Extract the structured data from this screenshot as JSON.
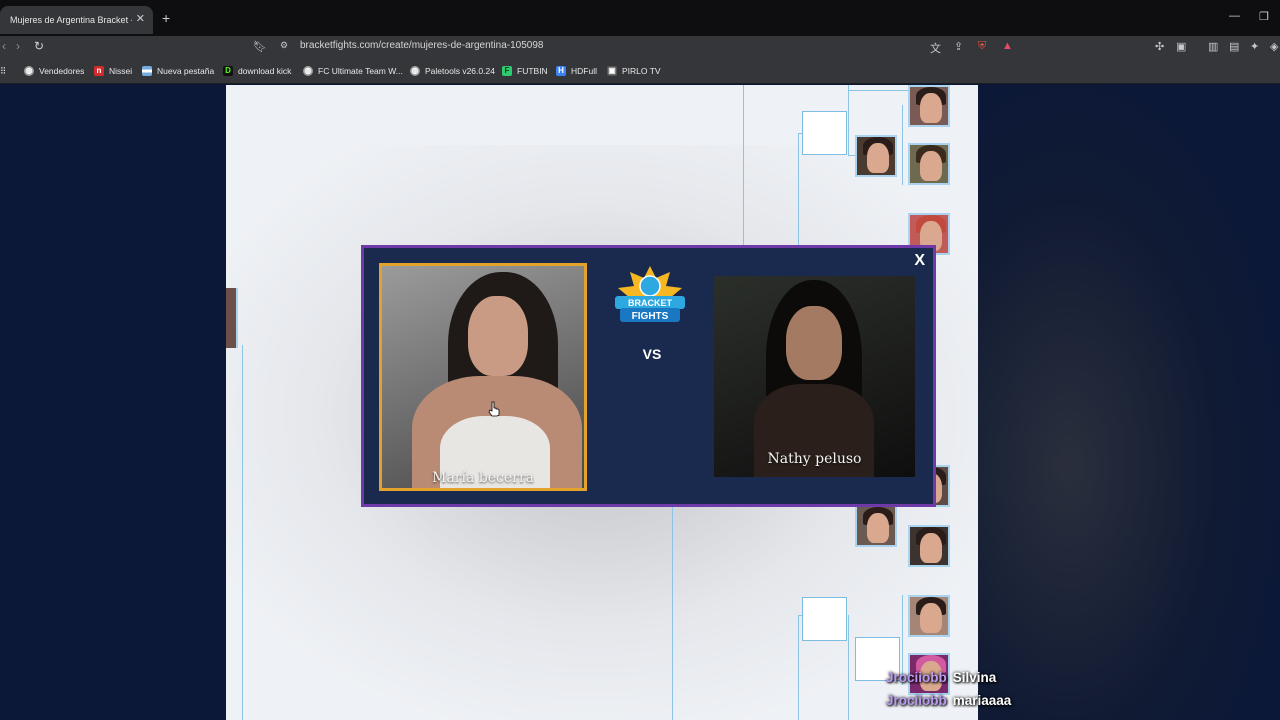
{
  "browser": {
    "tab_title": "Mujeres de Argentina Bracket - B",
    "tab_close": "✕",
    "new_tab": "+",
    "url": "bracketfights.com/create/mujeres-de-argentina-105098",
    "bookmarks": [
      {
        "label": "Vendedores",
        "icon": "globe-icon",
        "color": "#bdbdbd"
      },
      {
        "label": "Nissei",
        "icon": "nissei-icon",
        "color": "#d12b2b"
      },
      {
        "label": "Nueva pestaña",
        "icon": "argentina-flag-icon",
        "color": "#74acdf"
      },
      {
        "label": "download kick",
        "icon": "kick-icon",
        "color": "#53fc18"
      },
      {
        "label": "FC Ultimate Team W...",
        "icon": "globe-icon",
        "color": "#bdbdbd"
      },
      {
        "label": "Paletools v26.0.24",
        "icon": "globe-icon",
        "color": "#bdbdbd"
      },
      {
        "label": "FUTBIN",
        "icon": "futbin-icon",
        "color": "#2ecc71"
      },
      {
        "label": "HDFull",
        "icon": "hdfull-icon",
        "color": "#3b82f6"
      },
      {
        "label": "PIRLO TV",
        "icon": "pirlo-icon",
        "color": "#dcdcdc"
      }
    ]
  },
  "modal": {
    "close_label": "X",
    "vs_label": "VS",
    "logo_text": [
      "BRACKET",
      "FIGHTS"
    ],
    "contestant_left": {
      "name": "María becerra",
      "selected": true
    },
    "contestant_right": {
      "name": "Nathy peluso",
      "selected": false
    }
  },
  "chat": [
    {
      "user": "Jrociiobb",
      "message": "Silvina"
    },
    {
      "user": "Jrociiobb",
      "message": "mariaaaa"
    }
  ],
  "colors": {
    "page_bg": "#0b1838",
    "modal_bg": "#1a2a4f",
    "modal_border": "#6f3aa7",
    "selected_border": "#e3a32a",
    "bracket_line": "#8cc4e6",
    "chat_user": "#b99af0"
  }
}
